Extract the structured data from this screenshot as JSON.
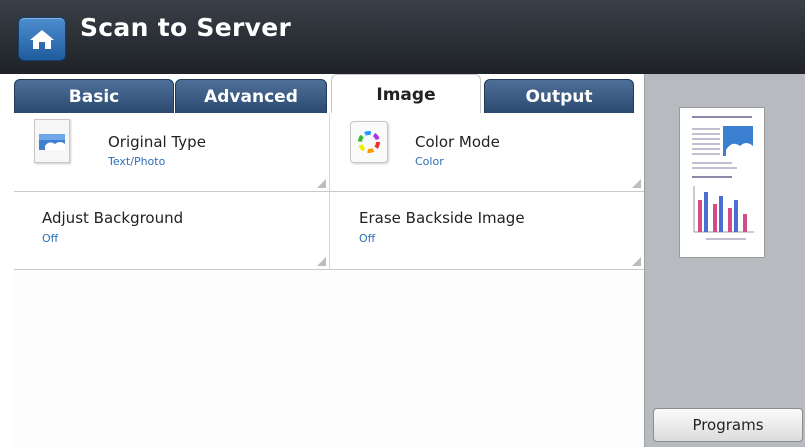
{
  "header": {
    "title": "Scan to Server",
    "home_icon": "home-icon"
  },
  "tabs": [
    {
      "label": "Basic",
      "active": false
    },
    {
      "label": "Advanced",
      "active": false
    },
    {
      "label": "Image",
      "active": true
    },
    {
      "label": "Output",
      "active": false
    }
  ],
  "settings": {
    "original_type": {
      "title": "Original Type",
      "value": "Text/Photo",
      "icon": "original-type-icon"
    },
    "color_mode": {
      "title": "Color Mode",
      "value": "Color",
      "icon": "color-wheel-icon"
    },
    "adjust_background": {
      "title": "Adjust Background",
      "value": "Off"
    },
    "erase_backside": {
      "title": "Erase Backside Image",
      "value": "Off"
    }
  },
  "sidebar": {
    "programs_label": "Programs",
    "preview_icon": "document-preview-icon"
  },
  "colors": {
    "header_dark": "#2a2e35",
    "tab_blue": "#3b5b83",
    "value_blue": "#2d6fb8",
    "side_gray": "#b7bbbf"
  }
}
